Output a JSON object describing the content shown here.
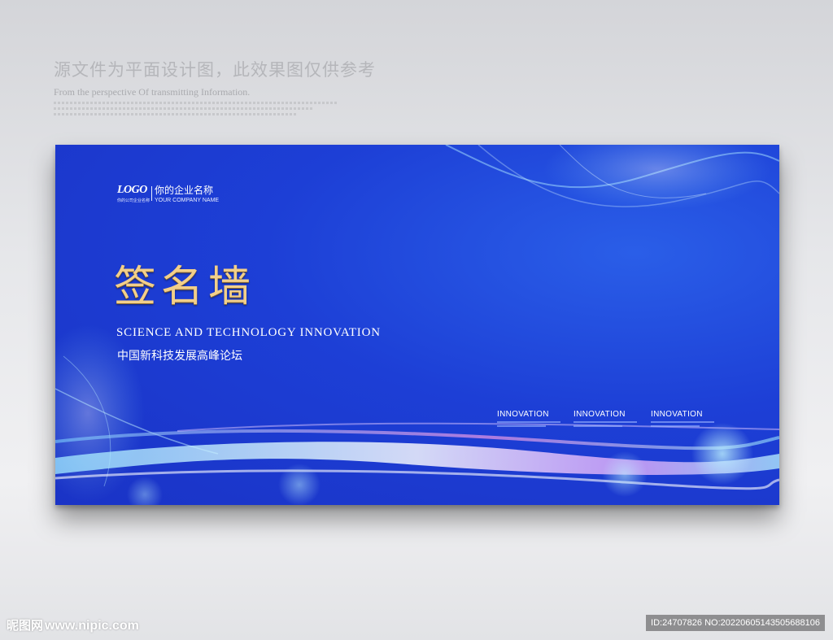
{
  "disclaimer": {
    "title": "源文件为平面设计图，此效果图仅供参考",
    "subtitle": "From the perspective Of transmitting Information."
  },
  "board": {
    "logo": {
      "text": "LOGO",
      "sub": "你的公司企业名称",
      "company_cn": "你的企业名称",
      "company_en": "YOUR COMPANY NAME"
    },
    "title": "签名墙",
    "subtitle_en": "SCIENCE AND TECHNOLOGY INNOVATION",
    "subtitle_cn": "中国新科技发展高峰论坛",
    "innovations": [
      {
        "title": "INNOVATION"
      },
      {
        "title": "INNOVATION"
      },
      {
        "title": "INNOVATION"
      }
    ]
  },
  "watermark": {
    "brand": "昵图网",
    "url": "www.nipic.com",
    "id": "ID:24707826 NO:20220605143505688106"
  },
  "colors": {
    "board_blue": "#1d3fd6",
    "title_gold": "#f2cf8a"
  }
}
